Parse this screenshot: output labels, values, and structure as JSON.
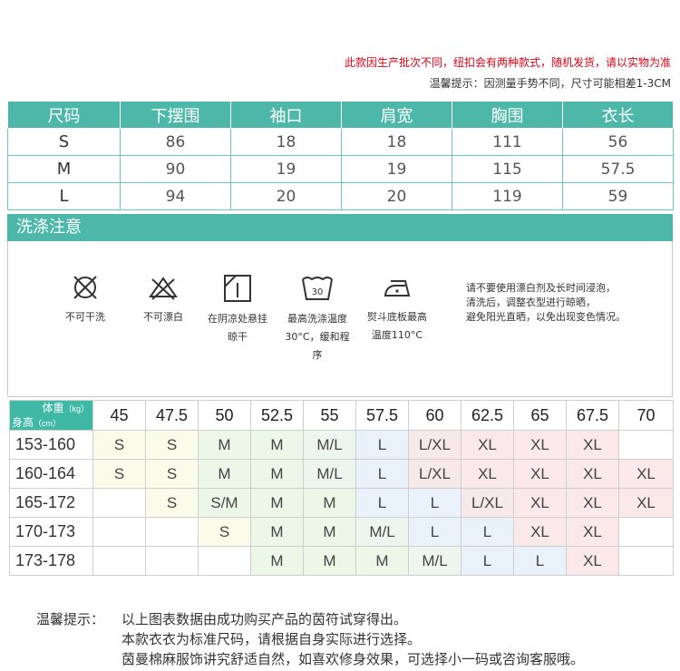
{
  "notices": {
    "red": "此款因生产批次不同，纽扣会有两种款式，随机发货，请以实物为准",
    "gray": "温馨提示：因测量手势不同，尺寸可能相差1-3CM"
  },
  "measure_table": {
    "headers": [
      "尺码",
      "下摆围",
      "袖口",
      "肩宽",
      "胸围",
      "衣长"
    ],
    "rows": [
      [
        "S",
        "86",
        "18",
        "18",
        "111",
        "56"
      ],
      [
        "M",
        "90",
        "19",
        "19",
        "115",
        "57.5"
      ],
      [
        "L",
        "94",
        "20",
        "20",
        "119",
        "59"
      ]
    ]
  },
  "wash": {
    "title": "洗涤注意",
    "items": [
      {
        "icon": "no-dry-clean-icon",
        "label": "不可干洗"
      },
      {
        "icon": "no-bleach-icon",
        "label": "不可漂白"
      },
      {
        "icon": "shade-hang-dry-icon",
        "label": "在阴凉处悬挂\n晾干"
      },
      {
        "icon": "wash-30-icon",
        "label": "最高洗涤温度\n30°C，缓和程\n序"
      },
      {
        "icon": "iron-icon",
        "label": "熨斗底板最高\n温度110°C"
      }
    ],
    "note_lines": [
      "请不要使用漂白剂及长时间浸泡，",
      "清洗后，调整衣型进行晾晒，",
      "避免阳光直晒，以免出现变色情况。"
    ]
  },
  "recommend_table": {
    "corner_weight": "体重",
    "corner_weight_unit": "（kg）",
    "corner_height": "身高",
    "corner_height_unit": "（cm）",
    "weights": [
      "45",
      "47.5",
      "50",
      "52.5",
      "55",
      "57.5",
      "60",
      "62.5",
      "65",
      "67.5",
      "70"
    ],
    "rows": [
      {
        "height": "153-160",
        "sizes": [
          "S",
          "S",
          "M",
          "M",
          "M/L",
          "L",
          "L/XL",
          "XL",
          "XL",
          "XL",
          ""
        ]
      },
      {
        "height": "160-164",
        "sizes": [
          "S",
          "S",
          "M",
          "M",
          "M/L",
          "L",
          "L/XL",
          "XL",
          "XL",
          "XL",
          "XL"
        ]
      },
      {
        "height": "165-172",
        "sizes": [
          "",
          "S",
          "S/M",
          "M",
          "M",
          "L",
          "L",
          "L/XL",
          "XL",
          "XL",
          "XL"
        ]
      },
      {
        "height": "170-173",
        "sizes": [
          "",
          "",
          "S",
          "M",
          "M",
          "M/L",
          "L",
          "L",
          "XL",
          "XL",
          ""
        ]
      },
      {
        "height": "173-178",
        "sizes": [
          "",
          "",
          "",
          "M",
          "M",
          "M",
          "M/L",
          "L",
          "L",
          "XL",
          ""
        ]
      }
    ]
  },
  "tips": {
    "label": "温馨提示：",
    "lines": [
      "以上图表数据由成功购买产品的茵符试穿得出。",
      "本款衣衣为标准尺码，请根据自身实际进行选择。",
      "茵曼棉麻服饰讲究舒适自然，如喜欢修身效果，可选择小一码或咨询客服哦。"
    ]
  },
  "colors": {
    "teal": "#4db8aa",
    "red_notice": "#e60012",
    "cell_S": "#fbfbe9",
    "cell_M": "#ecf7e8",
    "cell_L": "#e9f1fb",
    "cell_XL": "#fbe9ea"
  }
}
